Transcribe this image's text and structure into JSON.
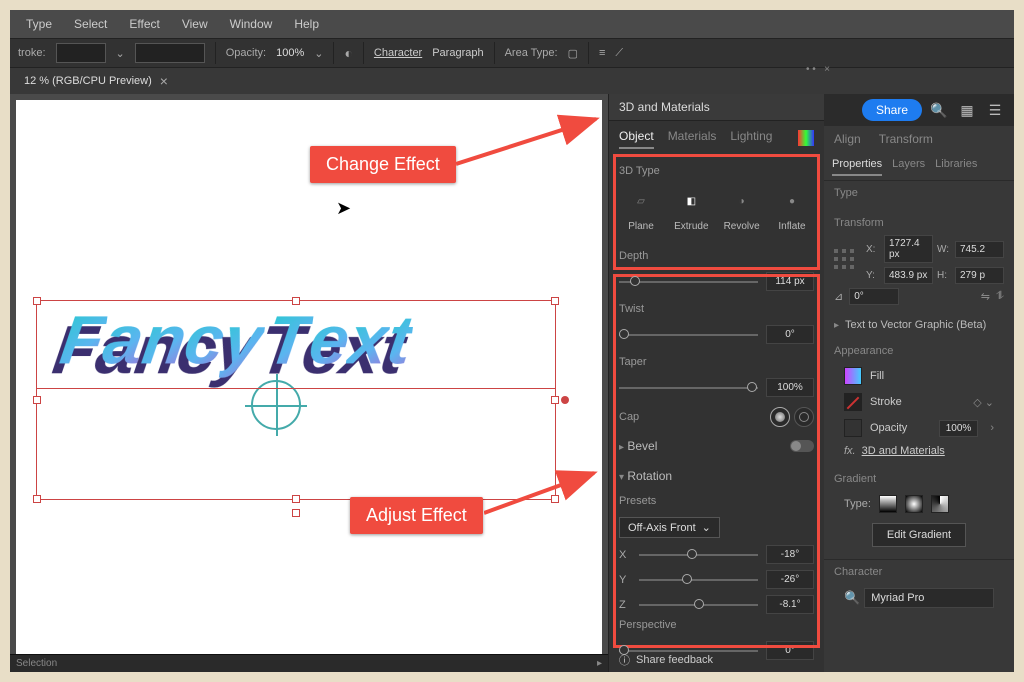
{
  "menu": [
    "Type",
    "Select",
    "Effect",
    "View",
    "Window",
    "Help"
  ],
  "toolbar": {
    "stroke_label": "troke:",
    "opacity_label": "Opacity:",
    "opacity_val": "100%",
    "char": "Character",
    "para": "Paragraph",
    "area": "Area Type:"
  },
  "tab": {
    "title": "12 % (RGB/CPU Preview)",
    "close": "×"
  },
  "share": "Share",
  "aligntrans": {
    "align": "Align",
    "transform": "Transform"
  },
  "panel3d": {
    "title": "3D and Materials",
    "tabs": [
      "Object",
      "Materials",
      "Lighting"
    ],
    "sec_type": "3D Type",
    "types": [
      "Plane",
      "Extrude",
      "Revolve",
      "Inflate"
    ],
    "depth_label": "Depth",
    "depth_val": "114 px",
    "twist_label": "Twist",
    "twist_val": "0°",
    "taper_label": "Taper",
    "taper_val": "100%",
    "cap_label": "Cap",
    "bevel": "Bevel",
    "rotation": "Rotation",
    "presets": "Presets",
    "preset_val": "Off-Axis Front",
    "x": "X",
    "x_val": "-18°",
    "y": "Y",
    "y_val": "-26°",
    "z": "Z",
    "z_val": "-8.1°",
    "persp": "Perspective",
    "persp_val": "0°",
    "feedback": "Share feedback"
  },
  "annot": {
    "change": "Change Effect",
    "adjust": "Adjust Effect"
  },
  "props": {
    "tabs": [
      "Properties",
      "Layers",
      "Libraries"
    ],
    "type_label": "Type",
    "transform_label": "Transform",
    "x": "X:",
    "x_val": "1727.4 px",
    "w": "W:",
    "w_val": "745.2",
    "y": "Y:",
    "y_val": "483.9 px",
    "h": "H:",
    "h_val": "279 p",
    "angle": "0°",
    "t2v": "Text to Vector Graphic (Beta)",
    "appearance": "Appearance",
    "fill": "Fill",
    "stroke": "Stroke",
    "opacity": "Opacity",
    "opacity_val": "100%",
    "fx": "3D and Materials",
    "gradient": "Gradient",
    "gtype": "Type:",
    "edit_grad": "Edit Gradient",
    "character": "Character",
    "font": "Myriad Pro"
  },
  "fancy": "FancyText",
  "status": {
    "selection": "Selection"
  }
}
